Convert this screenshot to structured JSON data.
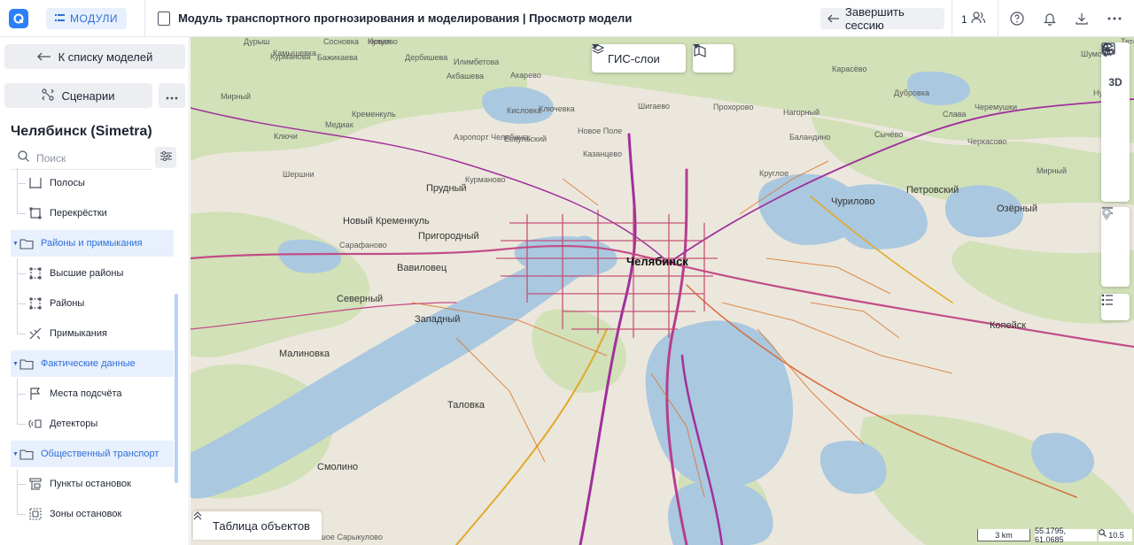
{
  "header": {
    "modules_label": "МОДУЛИ",
    "title": "Модуль транспортного прогнозирования и моделирования | Просмотр модели",
    "end_session_label": "Завершить сессию",
    "users_count": "1"
  },
  "sidebar": {
    "back_label": "К списку моделей",
    "scenarios_label": "Сценарии",
    "model_title": "Челябинск (Simetra)",
    "search_placeholder": "Поиск",
    "tree": [
      {
        "label": "Полосы",
        "type": "leaf",
        "icon": "lanes-icon"
      },
      {
        "label": "Перекрёстки",
        "type": "leaf",
        "icon": "intersection-icon"
      },
      {
        "label": "Районы и примыкания",
        "type": "group",
        "icon": "folder-icon"
      },
      {
        "label": "Высшие районы",
        "type": "leaf",
        "icon": "area-icon"
      },
      {
        "label": "Районы",
        "type": "leaf",
        "icon": "area-icon"
      },
      {
        "label": "Примыкания",
        "type": "leaf",
        "icon": "junction-icon"
      },
      {
        "label": "Фактические данные",
        "type": "group",
        "icon": "folder-icon"
      },
      {
        "label": "Места подсчёта",
        "type": "leaf",
        "icon": "flag-icon"
      },
      {
        "label": "Детекторы",
        "type": "leaf",
        "icon": "detector-icon"
      },
      {
        "label": "Общественный транспорт",
        "type": "group",
        "icon": "folder-icon"
      },
      {
        "label": "Пункты остановок",
        "type": "leaf",
        "icon": "stop-point-icon"
      },
      {
        "label": "Зоны остановок",
        "type": "leaf",
        "icon": "stop-zone-icon"
      }
    ]
  },
  "map": {
    "gis_layers_label": "ГИС-слои",
    "tool_3d_label": "3D",
    "objects_table_label": "Таблица объектов",
    "scale_label": "3 km",
    "coords_label": "55.1795, 61.0685",
    "zoom_label": "10.5",
    "labels": [
      {
        "text": "Челябинск",
        "cls": "big"
      },
      {
        "text": "Копейск",
        "cls": "md"
      },
      {
        "text": "Таловка",
        "cls": "md"
      },
      {
        "text": "Смолино",
        "cls": "md"
      },
      {
        "text": "Малиновка",
        "cls": "md"
      },
      {
        "text": "Северный",
        "cls": "md"
      },
      {
        "text": "Западный",
        "cls": "md"
      },
      {
        "text": "Вавиловец",
        "cls": "md"
      },
      {
        "text": "Пригородный",
        "cls": "md"
      },
      {
        "text": "Новый Кременкуль",
        "cls": "md"
      },
      {
        "text": "Прудный",
        "cls": "md"
      },
      {
        "text": "Чурилово",
        "cls": "md"
      },
      {
        "text": "Петровский",
        "cls": "md"
      },
      {
        "text": "Озёрный",
        "cls": "md"
      },
      {
        "text": "Мирный",
        "cls": ""
      },
      {
        "text": "Круглое",
        "cls": ""
      },
      {
        "text": "Казанцево",
        "cls": ""
      },
      {
        "text": "Новое Поле",
        "cls": ""
      },
      {
        "text": "Баландино",
        "cls": ""
      },
      {
        "text": "Сычёво",
        "cls": ""
      },
      {
        "text": "Черкасово",
        "cls": ""
      },
      {
        "text": "Нагорный",
        "cls": ""
      },
      {
        "text": "Прохорово",
        "cls": ""
      },
      {
        "text": "Шигаево",
        "cls": ""
      },
      {
        "text": "Ключевка",
        "cls": ""
      },
      {
        "text": "Сарафаново",
        "cls": ""
      },
      {
        "text": "Кременкуль",
        "cls": ""
      },
      {
        "text": "Шершни",
        "cls": ""
      },
      {
        "text": "Ключи",
        "cls": ""
      },
      {
        "text": "Медиак",
        "cls": ""
      },
      {
        "text": "Мирный",
        "cls": ""
      },
      {
        "text": "Камышевка",
        "cls": ""
      },
      {
        "text": "Курманова",
        "cls": ""
      },
      {
        "text": "Бажикаева",
        "cls": ""
      },
      {
        "text": "Дербишева",
        "cls": ""
      },
      {
        "text": "Илимбетова",
        "cls": ""
      },
      {
        "text": "Кулуево",
        "cls": ""
      },
      {
        "text": "Акбашева",
        "cls": ""
      },
      {
        "text": "Акарево",
        "cls": ""
      },
      {
        "text": "Карасёво",
        "cls": ""
      },
      {
        "text": "Дубровка",
        "cls": ""
      },
      {
        "text": "Слава",
        "cls": ""
      },
      {
        "text": "Черемушки",
        "cls": ""
      },
      {
        "text": "Нурова",
        "cls": ""
      },
      {
        "text": "Шумово",
        "cls": ""
      },
      {
        "text": "Тетёньков",
        "cls": ""
      },
      {
        "text": "Курманово",
        "cls": ""
      },
      {
        "text": "Аэропорт Челябинск",
        "cls": ""
      },
      {
        "text": "Есаульский",
        "cls": ""
      },
      {
        "text": "Кисловка",
        "cls": ""
      },
      {
        "text": "Новая",
        "cls": ""
      },
      {
        "text": "Сосновка",
        "cls": ""
      },
      {
        "text": "Дурыш",
        "cls": ""
      },
      {
        "text": "Большое Сарыкулово",
        "cls": ""
      }
    ]
  }
}
